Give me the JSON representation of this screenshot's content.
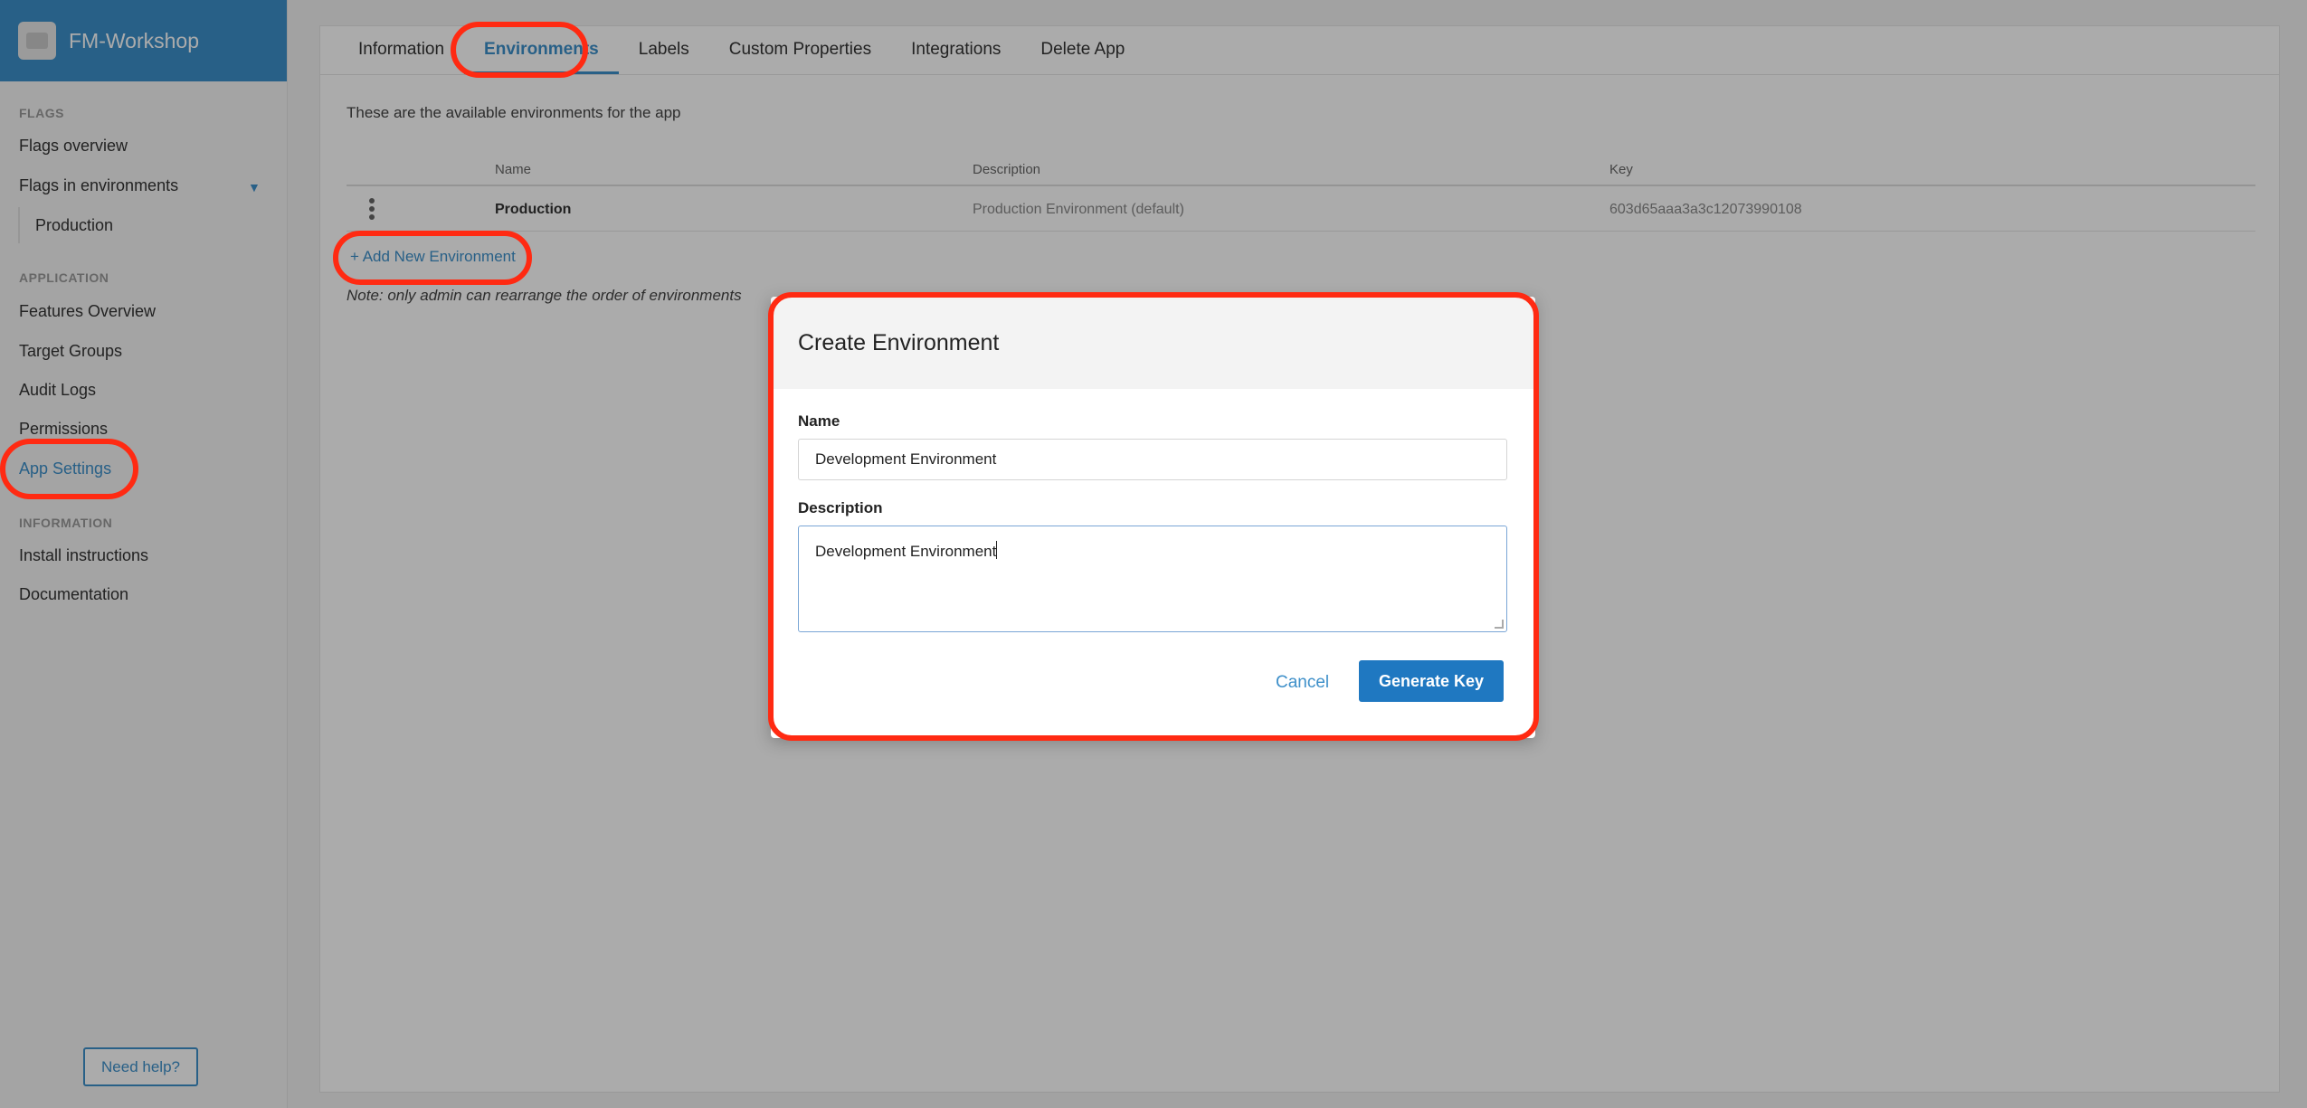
{
  "app": {
    "name": "FM-Workshop"
  },
  "sidebar": {
    "section_flags": "FLAGS",
    "flags_overview": "Flags overview",
    "flags_in_env": "Flags in environments",
    "caret": "▼",
    "env_production": "Production",
    "section_application": "APPLICATION",
    "features_overview": "Features Overview",
    "target_groups": "Target Groups",
    "audit_logs": "Audit Logs",
    "permissions": "Permissions",
    "app_settings": "App Settings",
    "section_information": "INFORMATION",
    "install_instructions": "Install instructions",
    "documentation": "Documentation",
    "help": "Need help?"
  },
  "tabs": {
    "information": "Information",
    "environments": "Environments",
    "labels": "Labels",
    "custom_properties": "Custom Properties",
    "integrations": "Integrations",
    "delete_app": "Delete App"
  },
  "environments": {
    "intro": "These are the available environments for the app",
    "columns": {
      "name": "Name",
      "description": "Description",
      "key": "Key"
    },
    "rows": [
      {
        "name": "Production",
        "description": "Production Environment (default)",
        "key": "603d65aaa3a3c12073990108"
      }
    ],
    "add": "+ Add New Environment",
    "note": "Note: only admin can rearrange the order of environments"
  },
  "modal": {
    "title": "Create Environment",
    "name_label": "Name",
    "name_value": "Development Environment",
    "description_label": "Description",
    "description_value": "Development Environment",
    "cancel": "Cancel",
    "submit": "Generate Key"
  },
  "colors": {
    "brand": "#3d8fc9",
    "primary": "#1f78c1",
    "annotation": "#ff2a12"
  }
}
